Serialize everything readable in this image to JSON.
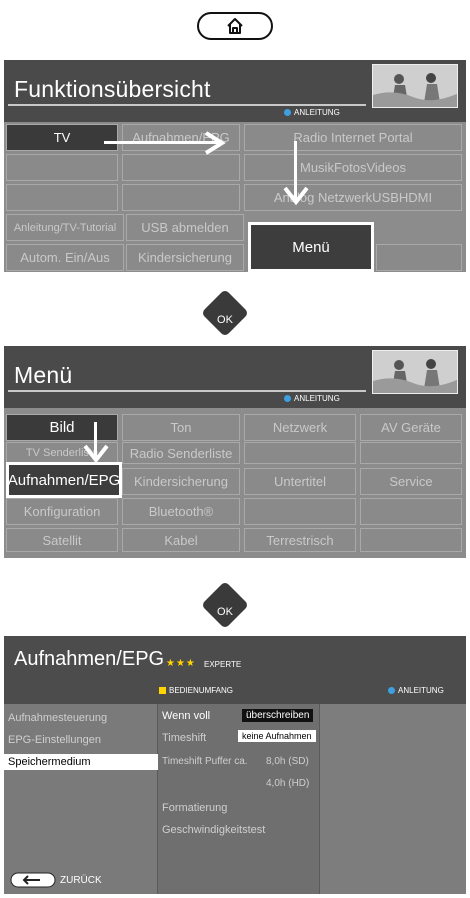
{
  "panel1": {
    "title": "Funktionsübersicht",
    "anleitung": "ANLEITUNG",
    "cells": {
      "tv": "TV",
      "aufnahmen": "Aufnahmen/EPG",
      "radio_internet": "Radio Internet Portal",
      "musik_fotos_videos": "MusikFotosVideos",
      "analog_netzwerk": "Analog NetzwerkUSBHDMI",
      "anleitung_tutorial": "Anleitung/TV-Tutorial",
      "usb_abmelden": "USB abmelden",
      "autom": "Autom. Ein/Aus",
      "kindersicherung": "Kindersicherung",
      "menu": "Menü"
    }
  },
  "ok_label": "OK",
  "panel2": {
    "title": "Menü",
    "anleitung": "ANLEITUNG",
    "cells": {
      "bild": "Bild",
      "ton": "Ton",
      "netzwerk": "Netzwerk",
      "av_geraete": "AV Geräte",
      "tv_senderliste": "TV Senderliste",
      "radio_senderliste": "Radio Senderliste",
      "aufnahmen": "Aufnahmen/EPG",
      "kindersicherung": "Kindersicherung",
      "untertitel": "Untertitel",
      "service": "Service",
      "konfiguration": "Konfiguration",
      "bluetooth": "Bluetooth®",
      "satellit": "Satellit",
      "kabel": "Kabel",
      "terrestrisch": "Terrestrisch"
    }
  },
  "panel3": {
    "title": "Aufnahmen/EPG",
    "stars": "★★★",
    "experte": "EXPERTE",
    "bedienumfang": "BEDIENUMFANG",
    "anleitung": "ANLEITUNG",
    "left_items": [
      "Aufnahmesteuerung",
      "EPG-Einstellungen",
      "Speichermedium"
    ],
    "settings": {
      "wenn_voll": "Wenn voll",
      "wenn_voll_value": "überschreiben",
      "timeshift": "Timeshift",
      "timeshift_value": "keine Aufnahmen",
      "puffer": "Timeshift Puffer ca.",
      "puffer_sd": "8,0h (SD)",
      "puffer_hd": "4,0h (HD)",
      "formatierung": "Formatierung",
      "geschwindigkeit": "Geschwindigkeitstest"
    },
    "back": "ZURÜCK"
  },
  "colors": {
    "accent_blue": "#3ea0e0",
    "star_yellow": "#ffd400",
    "panel_dark": "#4a4a4a"
  }
}
